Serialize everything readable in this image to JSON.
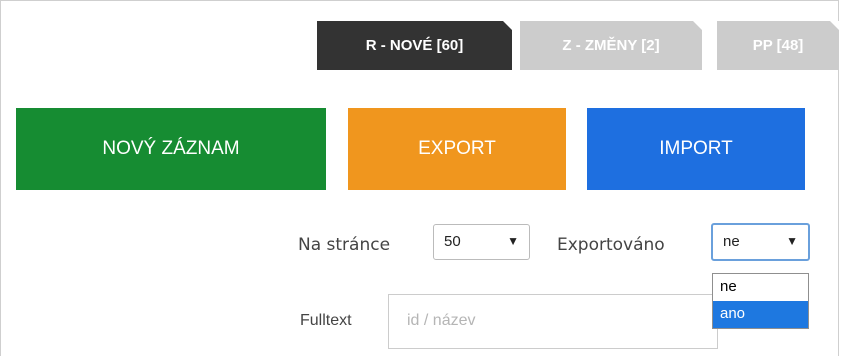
{
  "tabs": [
    {
      "label": "R - NOVÉ [60]",
      "active": true
    },
    {
      "label": "Z - ZMĚNY [2]",
      "active": false
    },
    {
      "label": "PP [48]",
      "active": false
    }
  ],
  "actions": {
    "new_record": {
      "label": "NOVÝ ZÁZNAM",
      "color": "#168c32"
    },
    "export": {
      "label": "EXPORT",
      "color": "#f0961e"
    },
    "import": {
      "label": "IMPORT",
      "color": "#1e6fe0"
    }
  },
  "filters": {
    "per_page": {
      "label": "Na stránce",
      "value": "50",
      "arrow": "▼"
    },
    "exported": {
      "label": "Exportováno",
      "value": "ne",
      "arrow": "▼",
      "options": [
        "ne",
        "ano"
      ],
      "highlighted_option": "ano"
    },
    "fulltext": {
      "label": "Fulltext",
      "placeholder": "id / název"
    }
  }
}
